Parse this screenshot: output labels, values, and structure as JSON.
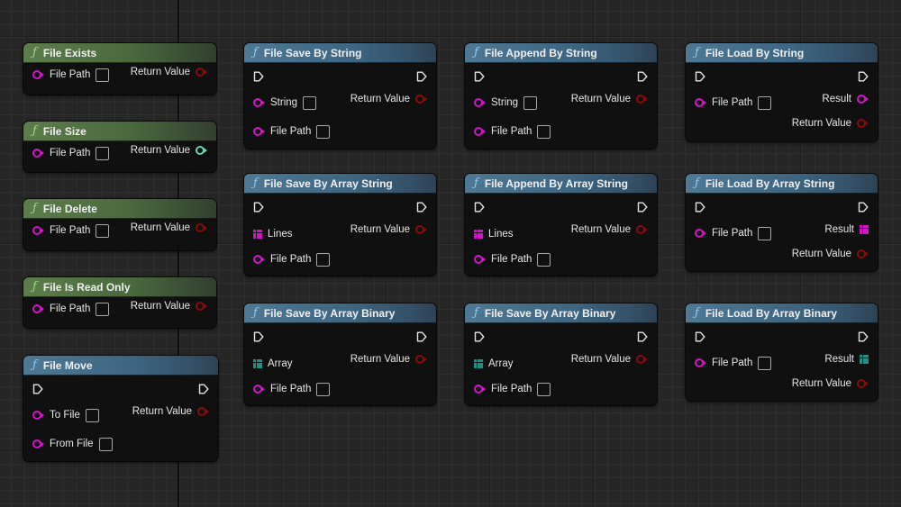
{
  "graph": {
    "nodes": [
      {
        "id": "file-exists",
        "title": "File Exists",
        "category": "green",
        "inputs": [
          {
            "label": "File Path",
            "type": "string",
            "has_box": true
          }
        ],
        "outputs": [
          {
            "label": "Return Value",
            "type": "bool"
          }
        ]
      },
      {
        "id": "file-size",
        "title": "File Size",
        "category": "green",
        "inputs": [
          {
            "label": "File Path",
            "type": "string",
            "has_box": true
          }
        ],
        "outputs": [
          {
            "label": "Return Value",
            "type": "int"
          }
        ]
      },
      {
        "id": "file-delete",
        "title": "File Delete",
        "category": "green",
        "inputs": [
          {
            "label": "File Path",
            "type": "string",
            "has_box": true
          }
        ],
        "outputs": [
          {
            "label": "Return Value",
            "type": "bool"
          }
        ]
      },
      {
        "id": "file-is-read-only",
        "title": "File Is Read Only",
        "category": "green",
        "inputs": [
          {
            "label": "File Path",
            "type": "string",
            "has_box": true
          }
        ],
        "outputs": [
          {
            "label": "Return Value",
            "type": "bool"
          }
        ]
      },
      {
        "id": "file-move",
        "title": "File Move",
        "category": "blue",
        "exec": true,
        "inputs": [
          {
            "label": "To File",
            "type": "string",
            "has_box": true
          },
          {
            "label": "From File",
            "type": "string",
            "has_box": true
          }
        ],
        "outputs": [
          {
            "label": "Return Value",
            "type": "bool"
          }
        ]
      },
      {
        "id": "file-save-by-string",
        "title": "File Save By String",
        "category": "blue",
        "exec": true,
        "inputs": [
          {
            "label": "String",
            "type": "string",
            "has_box": true
          },
          {
            "label": "File Path",
            "type": "string",
            "has_box": true
          }
        ],
        "outputs": [
          {
            "label": "Return Value",
            "type": "bool"
          }
        ]
      },
      {
        "id": "file-save-by-array-string",
        "title": "File Save By Array String",
        "category": "blue",
        "exec": true,
        "inputs": [
          {
            "label": "Lines",
            "type": "string-array"
          },
          {
            "label": "File Path",
            "type": "string",
            "has_box": true
          }
        ],
        "outputs": [
          {
            "label": "Return Value",
            "type": "bool"
          }
        ]
      },
      {
        "id": "file-save-by-array-binary",
        "title": "File Save By Array Binary",
        "category": "blue",
        "exec": true,
        "inputs": [
          {
            "label": "Array",
            "type": "byte-array"
          },
          {
            "label": "File Path",
            "type": "string",
            "has_box": true
          }
        ],
        "outputs": [
          {
            "label": "Return Value",
            "type": "bool"
          }
        ]
      },
      {
        "id": "file-append-by-string",
        "title": "File Append By String",
        "category": "blue",
        "exec": true,
        "inputs": [
          {
            "label": "String",
            "type": "string",
            "has_box": true
          },
          {
            "label": "File Path",
            "type": "string",
            "has_box": true
          }
        ],
        "outputs": [
          {
            "label": "Return Value",
            "type": "bool"
          }
        ]
      },
      {
        "id": "file-append-by-array-string",
        "title": "File Append By Array String",
        "category": "blue",
        "exec": true,
        "inputs": [
          {
            "label": "Lines",
            "type": "string-array"
          },
          {
            "label": "File Path",
            "type": "string",
            "has_box": true
          }
        ],
        "outputs": [
          {
            "label": "Return Value",
            "type": "bool"
          }
        ]
      },
      {
        "id": "file-save-by-array-binary-2",
        "title": "File Save By Array Binary",
        "category": "blue",
        "exec": true,
        "inputs": [
          {
            "label": "Array",
            "type": "byte-array"
          },
          {
            "label": "File Path",
            "type": "string",
            "has_box": true
          }
        ],
        "outputs": [
          {
            "label": "Return Value",
            "type": "bool"
          }
        ]
      },
      {
        "id": "file-load-by-string",
        "title": "File Load By String",
        "category": "blue",
        "exec": true,
        "inputs": [
          {
            "label": "File Path",
            "type": "string",
            "has_box": true
          }
        ],
        "outputs": [
          {
            "label": "Result",
            "type": "string"
          },
          {
            "label": "Return Value",
            "type": "bool"
          }
        ]
      },
      {
        "id": "file-load-by-array-string",
        "title": "File Load By Array String",
        "category": "blue",
        "exec": true,
        "inputs": [
          {
            "label": "File Path",
            "type": "string",
            "has_box": true
          }
        ],
        "outputs": [
          {
            "label": "Result",
            "type": "string-array"
          },
          {
            "label": "Return Value",
            "type": "bool"
          }
        ]
      },
      {
        "id": "file-load-by-array-binary",
        "title": "File Load By Array Binary",
        "category": "blue",
        "exec": true,
        "inputs": [
          {
            "label": "File Path",
            "type": "string",
            "has_box": true
          }
        ],
        "outputs": [
          {
            "label": "Result",
            "type": "byte-array"
          },
          {
            "label": "Return Value",
            "type": "bool"
          }
        ]
      }
    ]
  },
  "icons": {
    "function": "ƒ",
    "exec_pin": "exec-pin-icon",
    "string_pin": "string-pin-icon",
    "bool_pin": "bool-pin-icon",
    "int_pin": "int-pin-icon",
    "array_pin": "array-pin-icon"
  },
  "colors": {
    "pure_function_header": "#5c7c4c",
    "impure_function_header": "#4e7894",
    "string_pin": "#d412c9",
    "bool_pin": "#8b0a0a",
    "int_pin": "#6bd7a5",
    "byte_array_pin": "#1e8f80",
    "graph_background": "#262626"
  }
}
